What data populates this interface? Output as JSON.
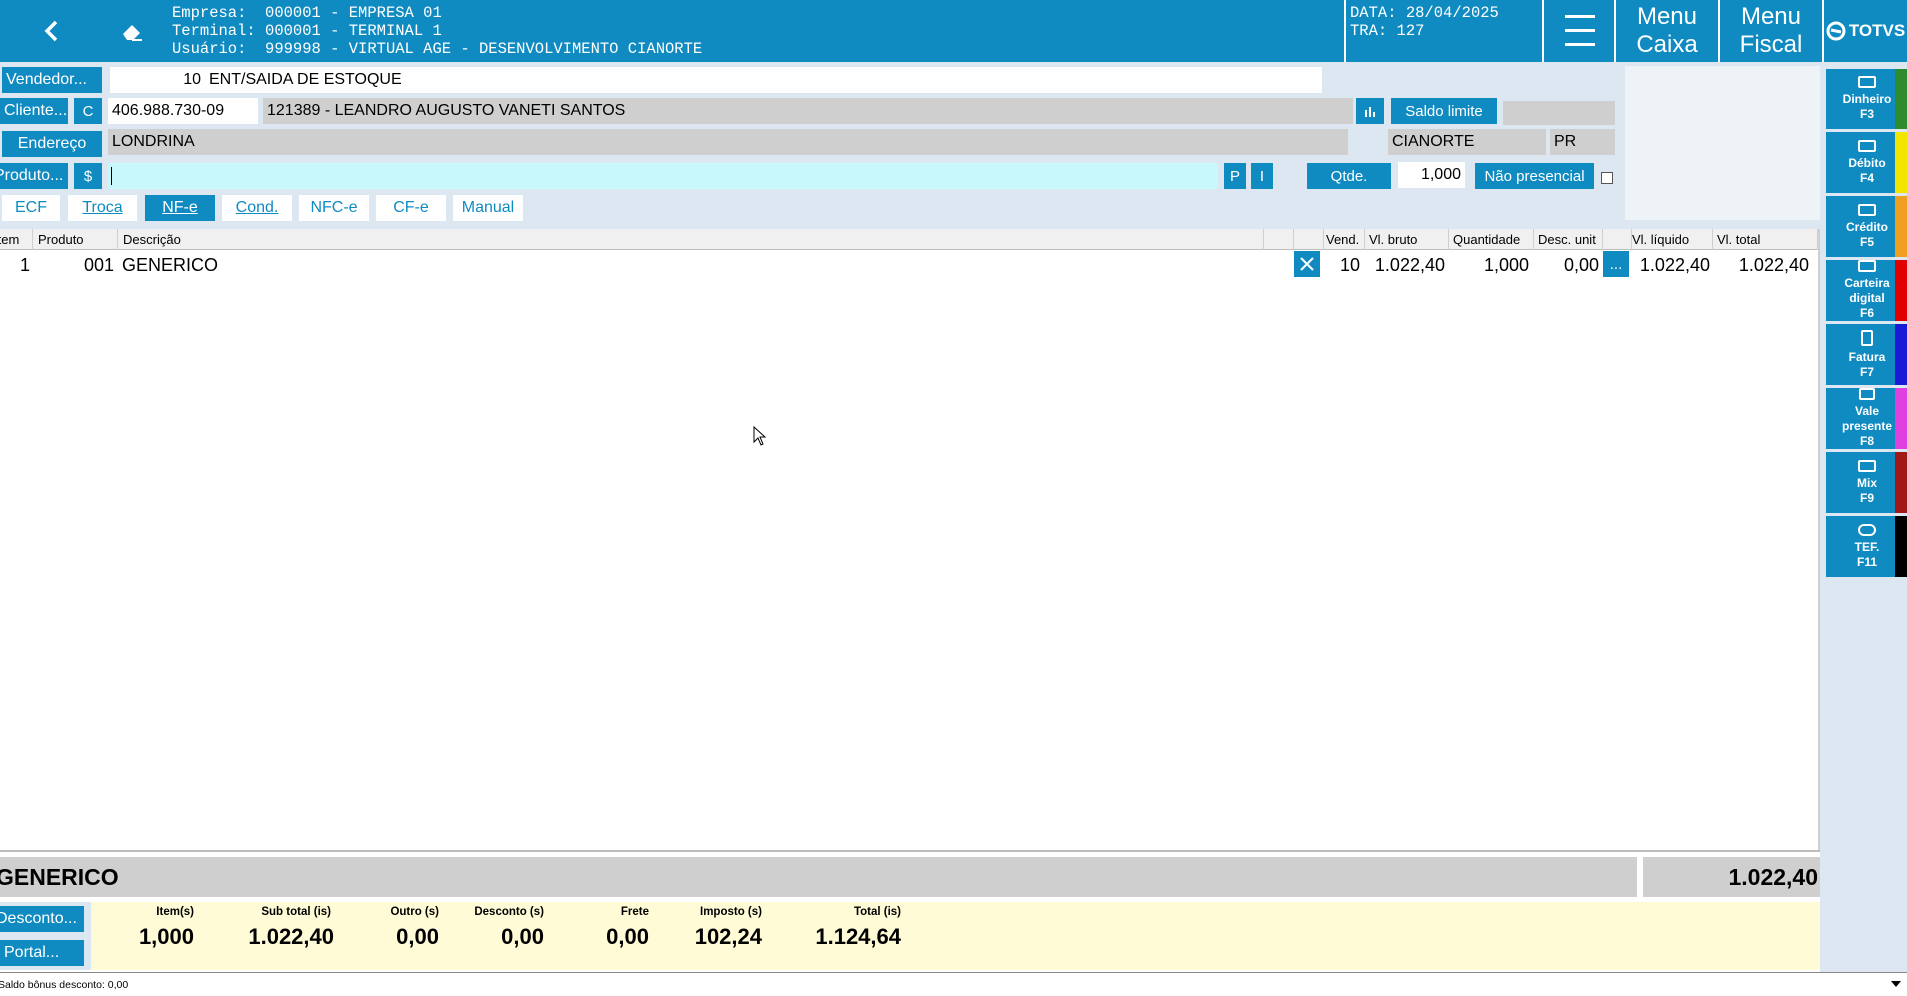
{
  "header": {
    "company_label": "Empresa:",
    "company_value": "000001 - EMPRESA 01",
    "terminal_label": "Terminal:",
    "terminal_value": "000001 - TERMINAL 1",
    "user_label": "Usuário:",
    "user_value": "999998 - VIRTUAL AGE - DESENVOLVIMENTO CIANORTE",
    "date_label": "DATA:",
    "date_value": "28/04/2025",
    "tra_label": "TRA:",
    "tra_value": "127",
    "menu_caixa_line1": "Menu",
    "menu_caixa_line2": "Caixa",
    "menu_fiscal_line1": "Menu",
    "menu_fiscal_line2": "Fiscal",
    "brand": "TOTVS"
  },
  "form": {
    "vendedor_label": "Vendedor...",
    "vendedor_code": "10",
    "vendedor_name": "ENT/SAIDA DE ESTOQUE",
    "cliente_label": "Cliente...",
    "cliente_c": "C",
    "cliente_cpf": "406.988.730-09",
    "cliente_name": "121389 - LEANDRO AUGUSTO VANETI SANTOS",
    "saldo_limite": "Saldo limite",
    "endereco_label": "Endereço",
    "endereco_city": "LONDRINA",
    "endereco_city2": "CIANORTE",
    "endereco_state": "PR",
    "produto_label": "Produto...",
    "produto_dollar": "$",
    "produto_value": "",
    "btn_p": "P",
    "btn_i": "I",
    "qtde_label": "Qtde.",
    "qtde_value": "1,000",
    "nao_presencial": "Não presencial"
  },
  "tabs": [
    {
      "label": "ECF",
      "active": false
    },
    {
      "label": "Troca",
      "active": false
    },
    {
      "label": "NF-e",
      "active": true
    },
    {
      "label": "Cond.",
      "active": false
    },
    {
      "label": "NFC-e",
      "active": false
    },
    {
      "label": "CF-e",
      "active": false
    },
    {
      "label": "Manual",
      "active": false
    }
  ],
  "grid": {
    "headers": {
      "item": "Item",
      "produto": "Produto",
      "descricao": "Descrição",
      "vend": "Vend.",
      "vl_bruto": "Vl. bruto",
      "quantidade": "Quantidade",
      "desc_unit": "Desc. unit",
      "vl_liquido": "Vl. líquido",
      "vl_total": "Vl. total"
    },
    "rows": [
      {
        "item": "1",
        "produto": "001",
        "descricao": "GENERICO",
        "vend": "10",
        "vl_bruto": "1.022,40",
        "quantidade": "1,000",
        "desc_unit": "0,00",
        "more": "...",
        "vl_liquido": "1.022,40",
        "vl_total": "1.022,40"
      }
    ]
  },
  "selected": {
    "name": "GENERICO",
    "value": "1.022,40"
  },
  "footer": {
    "desconto_btn": "Desconto...",
    "portal_btn": "Portal...",
    "totals": [
      {
        "label": "Item(s)",
        "value": "1,000"
      },
      {
        "label": "Sub total (is)",
        "value": "1.022,40"
      },
      {
        "label": "Outro (s)",
        "value": "0,00"
      },
      {
        "label": "Desconto (s)",
        "value": "0,00"
      },
      {
        "label": "Frete",
        "value": "0,00"
      },
      {
        "label": "Imposto (s)",
        "value": "102,24"
      },
      {
        "label": "Total (is)",
        "value": "1.124,64"
      }
    ],
    "status": "Saldo bônus desconto: 0,00"
  },
  "payments": [
    {
      "label": "Dinheiro",
      "key": "F3",
      "icon": "cash-icon",
      "color": "#2e8b2e"
    },
    {
      "label": "Débito",
      "key": "F4",
      "icon": "debit-card-icon",
      "color": "#f2e600"
    },
    {
      "label": "Crédito",
      "key": "F5",
      "icon": "credit-card-icon",
      "color": "#f0a020"
    },
    {
      "label": "Carteira digital",
      "key": "F6",
      "icon": "wallet-icon",
      "color": "#e00000"
    },
    {
      "label": "Fatura",
      "key": "F7",
      "icon": "invoice-icon",
      "color": "#1a1ad6"
    },
    {
      "label": "Vale presente",
      "key": "F8",
      "icon": "gift-icon",
      "color": "#e040e0"
    },
    {
      "label": "Mix",
      "key": "F9",
      "icon": "mix-payment-icon",
      "color": "#a01818"
    },
    {
      "label": "TEF.",
      "key": "F11",
      "icon": "tef-chat-icon",
      "color": "#000000"
    }
  ]
}
